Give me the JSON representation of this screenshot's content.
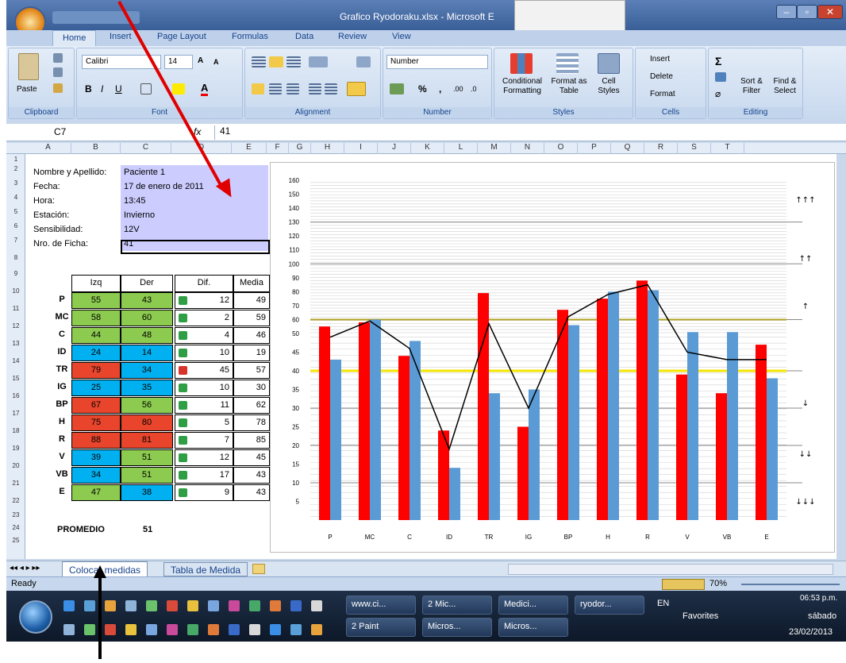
{
  "window": {
    "title": "Grafico Ryodoraku.xlsx - Microsoft E"
  },
  "tabs": [
    "Home",
    "Insert",
    "Page Layout",
    "Formulas",
    "Data",
    "Review",
    "View"
  ],
  "ribbon": {
    "paste": "Paste",
    "clipboard": "Clipboard",
    "font_name": "Calibri",
    "font_size": "14",
    "font_group": "Font",
    "alignment_group": "Alignment",
    "number_format": "Number",
    "number_group": "Number",
    "conditional": "Conditional Formatting",
    "format_table": "Format as Table",
    "cell_styles": "Cell Styles",
    "styles_group": "Styles",
    "insert": "Insert",
    "delete": "Delete",
    "format": "Format",
    "cells_group": "Cells",
    "sort": "Sort & Filter",
    "find": "Find & Select",
    "editing_group": "Editing",
    "pct": "%"
  },
  "formula": {
    "name_box": "C7",
    "fx": "fx",
    "value": "41"
  },
  "columns": [
    "A",
    "B",
    "C",
    "D",
    "E",
    "F",
    "G",
    "H",
    "I",
    "J",
    "K",
    "L",
    "M",
    "N",
    "O",
    "P",
    "Q",
    "R",
    "S",
    "T"
  ],
  "rows": [
    "1",
    "2",
    "3",
    "4",
    "5",
    "6",
    "7",
    "8",
    "9",
    "10",
    "11",
    "12",
    "13",
    "14",
    "15",
    "16",
    "17",
    "18",
    "19",
    "20",
    "21",
    "22",
    "23",
    "24",
    "25"
  ],
  "info": [
    {
      "label": "Nombre y Apellido:",
      "value": "Paciente 1"
    },
    {
      "label": "Fecha:",
      "value": "17 de enero de 2011"
    },
    {
      "label": "Hora:",
      "value": "13:45"
    },
    {
      "label": "Estación:",
      "value": "Invierno"
    },
    {
      "label": "Sensibilidad:",
      "value": "12V"
    },
    {
      "label": "Nro. de Ficha:",
      "value": "41"
    }
  ],
  "table": {
    "headers": [
      "Izq",
      "Der",
      "Dif.",
      "Media"
    ],
    "rows": [
      {
        "name": "P",
        "izq": "55",
        "der": "43",
        "dif": "12",
        "media": "49",
        "ci": "#8ccb4f",
        "cd": "#8ccb4f",
        "arrow": "up"
      },
      {
        "name": "MC",
        "izq": "58",
        "der": "60",
        "dif": "2",
        "media": "59",
        "ci": "#8ccb4f",
        "cd": "#8ccb4f",
        "arrow": "up"
      },
      {
        "name": "C",
        "izq": "44",
        "der": "48",
        "dif": "4",
        "media": "46",
        "ci": "#8ccb4f",
        "cd": "#8ccb4f",
        "arrow": "up"
      },
      {
        "name": "ID",
        "izq": "24",
        "der": "14",
        "dif": "10",
        "media": "19",
        "ci": "#00b0f0",
        "cd": "#00b0f0",
        "arrow": "up"
      },
      {
        "name": "TR",
        "izq": "79",
        "der": "34",
        "dif": "45",
        "media": "57",
        "ci": "#e8452c",
        "cd": "#00b0f0",
        "arrow": "down"
      },
      {
        "name": "IG",
        "izq": "25",
        "der": "35",
        "dif": "10",
        "media": "30",
        "ci": "#00b0f0",
        "cd": "#00b0f0",
        "arrow": "up"
      },
      {
        "name": "BP",
        "izq": "67",
        "der": "56",
        "dif": "11",
        "media": "62",
        "ci": "#e8452c",
        "cd": "#8ccb4f",
        "arrow": "up"
      },
      {
        "name": "H",
        "izq": "75",
        "der": "80",
        "dif": "5",
        "media": "78",
        "ci": "#e8452c",
        "cd": "#e8452c",
        "arrow": "up"
      },
      {
        "name": "R",
        "izq": "88",
        "der": "81",
        "dif": "7",
        "media": "85",
        "ci": "#e8452c",
        "cd": "#e8452c",
        "arrow": "up"
      },
      {
        "name": "V",
        "izq": "39",
        "der": "51",
        "dif": "12",
        "media": "45",
        "ci": "#00b0f0",
        "cd": "#8ccb4f",
        "arrow": "up"
      },
      {
        "name": "VB",
        "izq": "34",
        "der": "51",
        "dif": "17",
        "media": "43",
        "ci": "#00b0f0",
        "cd": "#8ccb4f",
        "arrow": "up"
      },
      {
        "name": "E",
        "izq": "47",
        "der": "38",
        "dif": "9",
        "media": "43",
        "ci": "#8ccb4f",
        "cd": "#00b0f0",
        "arrow": "up"
      }
    ],
    "promedio_label": "PROMEDIO",
    "promedio_value": "51"
  },
  "chart_data": {
    "type": "bar",
    "categories": [
      "P",
      "MC",
      "C",
      "ID",
      "TR",
      "IG",
      "BP",
      "H",
      "R",
      "V",
      "VB",
      "E"
    ],
    "series": [
      {
        "values": [
          55,
          58,
          44,
          24,
          79,
          25,
          67,
          75,
          88,
          39,
          34,
          47
        ],
        "color": "#ff0000"
      },
      {
        "values": [
          43,
          60,
          48,
          14,
          34,
          35,
          56,
          80,
          81,
          51,
          51,
          38
        ],
        "color": "#5b9bd5"
      }
    ],
    "line": [
      49,
      59,
      46,
      19,
      57,
      30,
      62,
      78,
      85,
      45,
      43,
      43
    ],
    "yticks": [
      "5",
      "10",
      "15",
      "20",
      "25",
      "30",
      "35",
      "40",
      "45",
      "50",
      "60",
      "70",
      "80",
      "90",
      "100",
      "110",
      "120",
      "130",
      "140",
      "150",
      "160"
    ],
    "zone_labels": [
      "↑↑↑",
      "↑↑",
      "↑",
      "↓",
      "↓↓",
      "↓↓↓"
    ],
    "ref_lines": {
      "yellow": 40,
      "olive": 60
    }
  },
  "sheet_tabs": [
    "Colocar medidas",
    "Tabla de Medida"
  ],
  "status": {
    "ready": "Ready",
    "zoom": "70%"
  },
  "taskbar": {
    "items_top": [
      "www.ci...",
      "2 Mic...",
      "Medici...",
      "ryodor..."
    ],
    "items_bottom": [
      "2 Paint",
      "Micros...",
      "Micros..."
    ],
    "lang": "EN",
    "favorites": "Favorites",
    "time": "06:53 p.m.",
    "day": "sábado",
    "date": "23/02/2013"
  }
}
